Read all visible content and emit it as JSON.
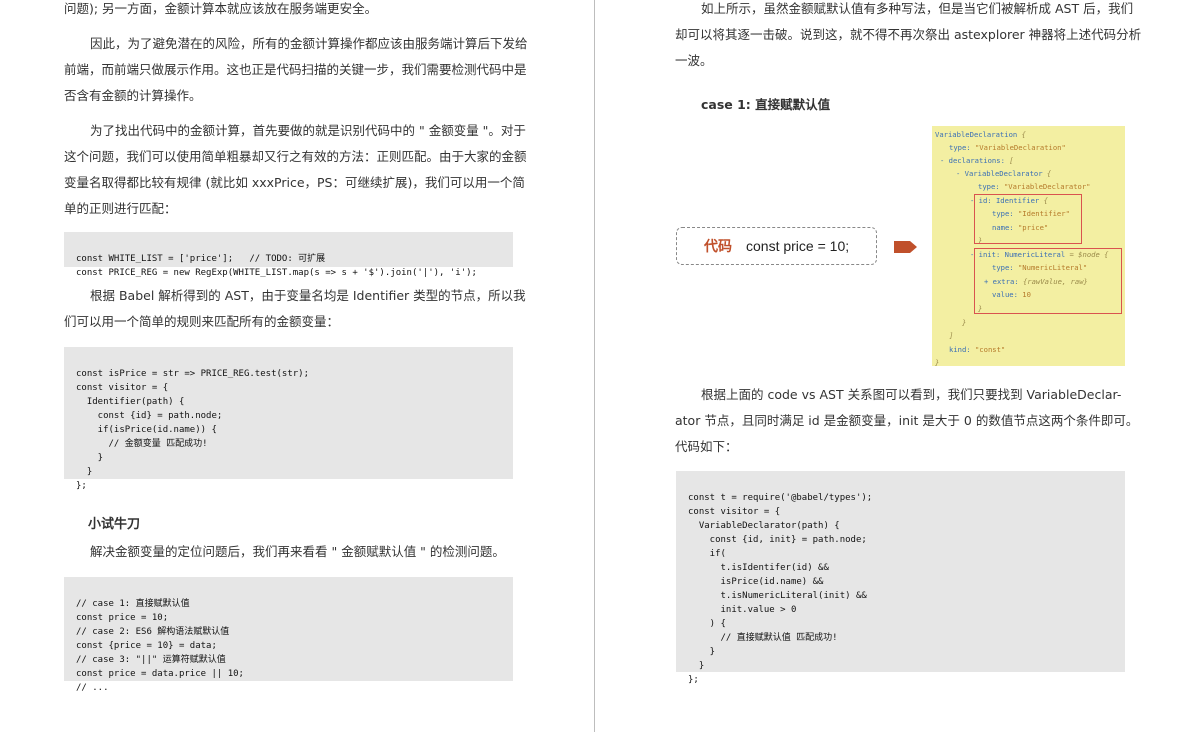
{
  "left": {
    "intro_line": "问题); 另一方面，金额计算本就应该放在服务端更安全。",
    "para1": [
      "因此，为了避免潜在的风险，所有的金额计算操作都应该由服务端计算后下发给",
      "前端，而前端只做展示作用。这也正是代码扫描的关键一步，我们需要检测代码中是",
      "否含有金额的计算操作。"
    ],
    "para2": [
      "为了找出代码中的金额计算，首先要做的就是识别代码中的 \" 金额变量 \"。对于",
      "这个问题，我们可以使用简单粗暴却又行之有效的方法：正则匹配。由于大家的金额",
      "变量名取得都比较有规律 (就比如 xxxPrice，PS：可继续扩展)，我们可以用一个简",
      "单的正则进行匹配："
    ],
    "code1": [
      "const WHITE_LIST = ['price'];   // TODO: 可扩展",
      "const PRICE_REG = new RegExp(WHITE_LIST.map(s => s + '$').join('|'), 'i');"
    ],
    "para3": [
      "根据 Babel 解析得到的 AST，由于变量名均是 Identifier 类型的节点，所以我",
      "们可以用一个简单的规则来匹配所有的金额变量："
    ],
    "code2": [
      "const isPrice = str => PRICE_REG.test(str);",
      "const visitor = {",
      "  Identifier(path) {",
      "    const {id} = path.node;",
      "    if(isPrice(id.name)) {",
      "      // 金额变量 匹配成功!",
      "    }",
      "  }",
      "};"
    ],
    "heading": "小试牛刀",
    "para4": "解决金额变量的定位问题后，我们再来看看 \" 金额赋默认值 \" 的检测问题。",
    "code3": [
      "// case 1: 直接赋默认值",
      "const price = 10;",
      "// case 2: ES6 解构语法赋默认值",
      "const {price = 10} = data;",
      "// case 3: \"||\" 运算符赋默认值",
      "const price = data.price || 10;",
      "// ..."
    ]
  },
  "right": {
    "para1": [
      "如上所示，虽然金额赋默认值有多种写法，但是当它们被解析成 AST 后，我们",
      "却可以将其逐一击破。说到这，就不得不再次祭出 astexplorer 神器将上述代码分析",
      "一波。"
    ],
    "case_heading": "case 1: 直接赋默认值",
    "diagram": {
      "code_label": "代码",
      "code_expr": "const price = 10;",
      "ast": {
        "l1k": "VariableDeclaration",
        "l1b": "{",
        "l2k": "type:",
        "l2v": "\"VariableDeclaration\"",
        "l3k": "- declarations:",
        "l3b": "[",
        "l4k": "- VariableDeclarator",
        "l4b": "{",
        "l5k": "type:",
        "l5v": "\"VariableDeclarator\"",
        "l6k": "- id: Identifier",
        "l6b": "{",
        "l7k": "type:",
        "l7v": "\"Identifier\"",
        "l8k": "name:",
        "l8v": "\"price\"",
        "l9": "}",
        "l10k": "- init: NumericLiteral",
        "l10d": "= $node {",
        "l11k": "type:",
        "l11v": "\"NumericLiteral\"",
        "l12k": "+ extra:",
        "l12d": "{rawValue, raw}",
        "l13k": "value:",
        "l13v": "10",
        "l14": "}",
        "l15": "}",
        "l16": "]",
        "l17k": "kind:",
        "l17v": "\"const\"",
        "l18": "}"
      }
    },
    "para2": [
      "根据上面的 code vs AST 关系图可以看到，我们只要找到 VariableDeclar-",
      "ator 节点，且同时满足 id 是金额变量，init 是大于 0 的数值节点这两个条件即可。",
      "代码如下："
    ],
    "code4": [
      "const t = require('@babel/types');",
      "const visitor = {",
      "  VariableDeclarator(path) {",
      "    const {id, init} = path.node;",
      "    if(",
      "      t.isIdentifer(id) &&",
      "      isPrice(id.name) &&",
      "      t.isNumericLiteral(init) &&",
      "      init.value > 0",
      "    ) {",
      "      // 直接赋默认值 匹配成功!",
      "    }",
      "  }",
      "};"
    ]
  },
  "colors": {
    "code_bg": "#e6e6e6",
    "ast_bg": "#f3efa2",
    "accent": "#c0502b",
    "highlight": "#d9534f"
  }
}
